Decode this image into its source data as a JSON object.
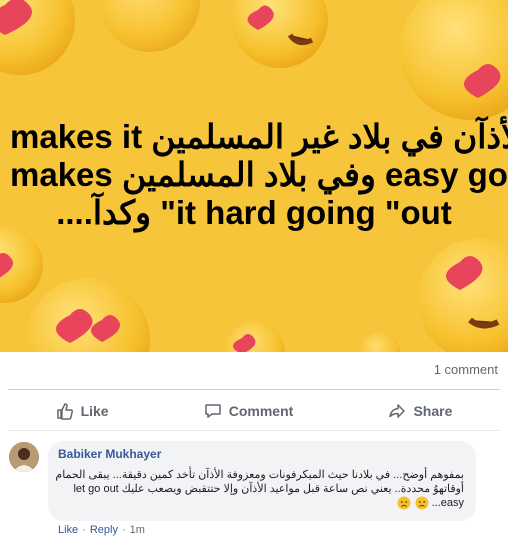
{
  "post": {
    "meme_lines": [
      "makes it الأذآن في بلاد غير المسلمين",
      "makes وفي بلاد المسلمين easy going",
      "....وكدآ \"it hard going \"out"
    ]
  },
  "stats": {
    "comments_label": "1 comment"
  },
  "actions": {
    "like": "Like",
    "comment": "Comment",
    "share": "Share"
  },
  "comment": {
    "author": "Babiker Mukhayer",
    "lines": [
      "بمفوهم أوضح... في بلادنا حيث الميكرفونات ومعزوفة الأذآن تأخد كمين دقيقة... يبقى الحمام",
      "أوقاتهوُ محددة.. يعني نص ساعة قبل مواعيد الأذآن وإلا حتتقبض ويصعب عليك let go out",
      "easy..."
    ],
    "footer": {
      "like": "Like",
      "reply": "Reply",
      "time": "1m",
      "dot": "·"
    }
  },
  "colors": {
    "meme_bg": "#f7c53a",
    "link": "#385898",
    "action_gray": "#606770"
  }
}
